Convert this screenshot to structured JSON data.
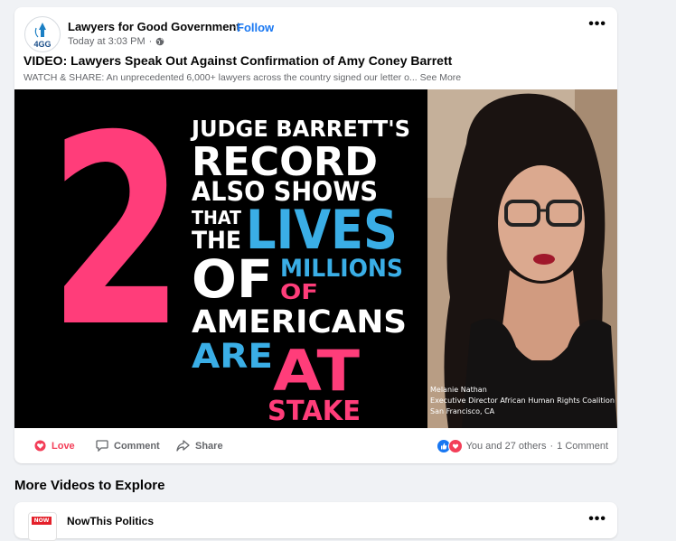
{
  "post": {
    "page_name": "Lawyers for Good Government",
    "follow_label": "Follow",
    "timestamp": "Today at 3:03 PM",
    "title": "VIDEO: Lawyers Speak Out Against Confirmation of Amy Coney Barrett",
    "description": "WATCH & SHARE: An unprecedented 6,000+ lawyers across the country signed our letter o...",
    "see_more": "See More",
    "avatar_logo": "4GG",
    "video": {
      "big_number": "2",
      "lines": [
        "JUDGE BARRETT'S",
        "RECORD",
        "ALSO SHOWS",
        "THAT",
        "THE",
        "LIVES",
        "OF",
        "MILLIONS",
        "OF",
        "AMERICANS",
        "ARE",
        "AT",
        "STAKE"
      ],
      "speaker_name": "Melanie Nathan",
      "speaker_title": "Executive Director African Human Rights Coalition",
      "speaker_location": "San Francisco, CA"
    },
    "actions": {
      "love": "Love",
      "comment": "Comment",
      "share": "Share"
    },
    "reactions_text": "You and 27 others",
    "comments_text": "1 Comment"
  },
  "section_heading": "More Videos to Explore",
  "next_post": {
    "page_name": "NowThis Politics",
    "logo_text": "NOW"
  },
  "colors": {
    "accent": "#1877f2",
    "love": "#f33e58",
    "video_pink": "#ff3d7a",
    "video_blue": "#3aaee6"
  }
}
